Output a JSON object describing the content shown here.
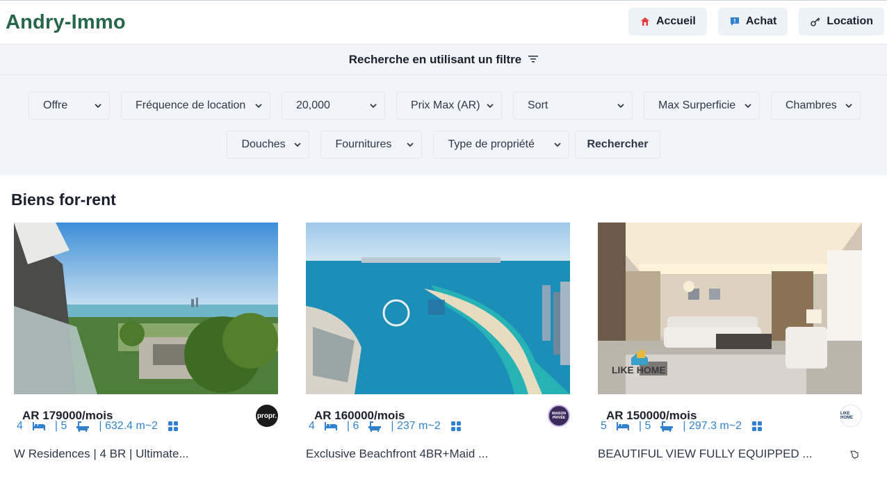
{
  "brand": "Andry-Immo",
  "nav": [
    {
      "label": "Accueil",
      "icon": "home-icon"
    },
    {
      "label": "Achat",
      "icon": "chat-icon"
    },
    {
      "label": "Location",
      "icon": "key-icon"
    }
  ],
  "filter": {
    "heading": "Recherche en utilisant un filtre",
    "row1": [
      "Offre",
      "Fréquence de location",
      "20,000",
      "Prix Max (AR)",
      "Sort",
      "Max Surperficie",
      "Chambres"
    ],
    "row2": [
      "Douches",
      "Fournitures",
      "Type de propriété"
    ],
    "search_label": "Rechercher"
  },
  "section_title": "Biens for-rent",
  "listings": [
    {
      "price": "AR 179000/mois",
      "rooms": "4",
      "baths": "| 5",
      "area": "| 632.4 m~2",
      "title": "W Residences | 4 BR | Ultimate...",
      "agency": "propr."
    },
    {
      "price": "AR 160000/mois",
      "rooms": "4",
      "baths": "| 6",
      "area": "| 237 m~2",
      "title": "Exclusive Beachfront 4BR+Maid ...",
      "agency": "MAISON PRIVÉE"
    },
    {
      "price": "AR 150000/mois",
      "rooms": "5",
      "baths": "| 5",
      "area": "| 297.3 m~2",
      "title": "BEAUTIFUL VIEW FULLY EQUIPPED ...",
      "agency": "LIKE HOME"
    }
  ],
  "colors": {
    "brand": "#276749",
    "accent": "#3182ce"
  }
}
